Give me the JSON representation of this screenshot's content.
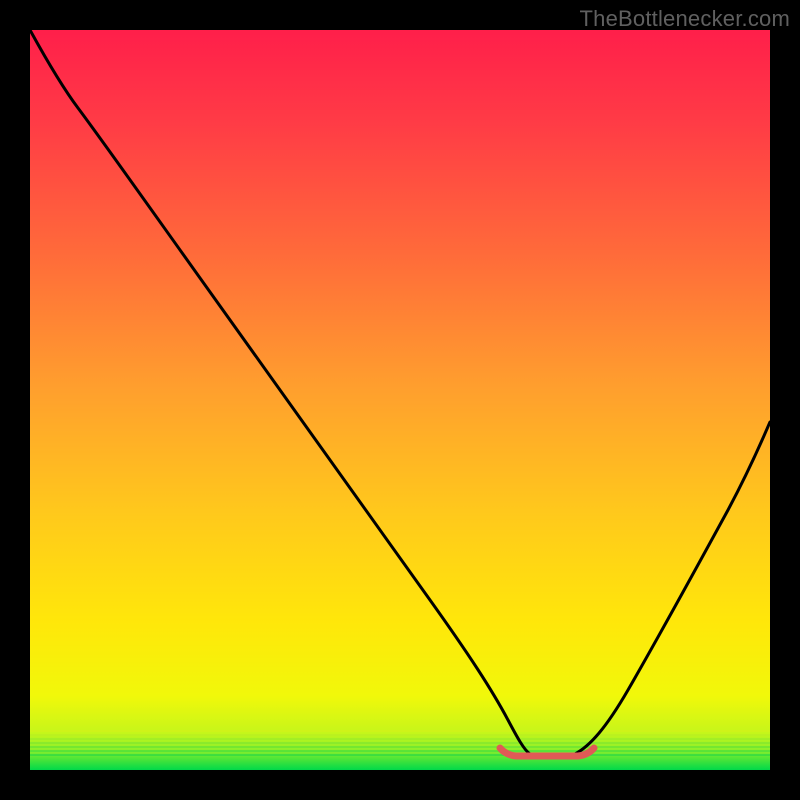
{
  "watermark": "TheBottlenecker.com",
  "chart_data": {
    "type": "line",
    "title": "",
    "xlabel": "",
    "ylabel": "",
    "xlim": [
      0,
      1
    ],
    "ylim": [
      0,
      1
    ],
    "background_gradient": {
      "top": "#ff2a4a",
      "mid": "#ffd400",
      "bottom_band": "#00e640"
    },
    "curve": {
      "description": "Black curve descending from top-left, reaching a flat minimum near x≈0.70, then rising toward the right edge",
      "stroke": "#000000",
      "points_normalized": [
        {
          "x": 0.0,
          "y": 1.0
        },
        {
          "x": 0.06,
          "y": 0.905
        },
        {
          "x": 0.11,
          "y": 0.83
        },
        {
          "x": 0.18,
          "y": 0.735
        },
        {
          "x": 0.26,
          "y": 0.625
        },
        {
          "x": 0.34,
          "y": 0.51
        },
        {
          "x": 0.42,
          "y": 0.395
        },
        {
          "x": 0.5,
          "y": 0.28
        },
        {
          "x": 0.56,
          "y": 0.18
        },
        {
          "x": 0.61,
          "y": 0.095
        },
        {
          "x": 0.645,
          "y": 0.037
        },
        {
          "x": 0.67,
          "y": 0.02
        },
        {
          "x": 0.705,
          "y": 0.02
        },
        {
          "x": 0.74,
          "y": 0.023
        },
        {
          "x": 0.775,
          "y": 0.055
        },
        {
          "x": 0.825,
          "y": 0.13
        },
        {
          "x": 0.87,
          "y": 0.21
        },
        {
          "x": 0.915,
          "y": 0.3
        },
        {
          "x": 0.96,
          "y": 0.39
        },
        {
          "x": 1.0,
          "y": 0.47
        }
      ]
    },
    "highlight_band": {
      "stroke": "#e05a56",
      "x_start": 0.635,
      "x_end": 0.76,
      "y": 0.02
    }
  }
}
